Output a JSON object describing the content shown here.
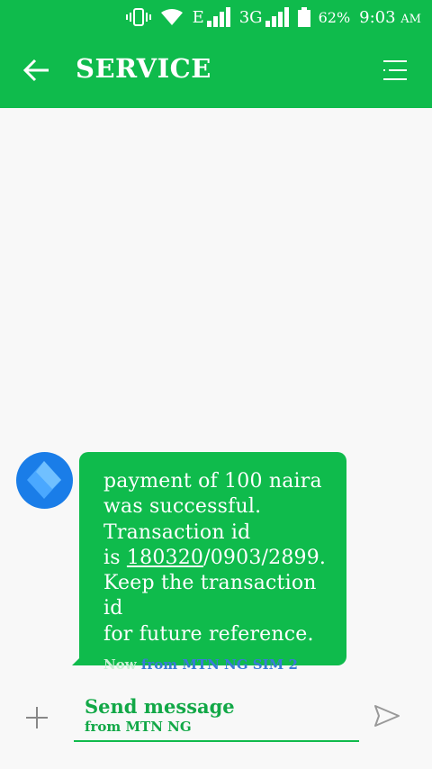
{
  "status_bar": {
    "network_type_1": "E",
    "network_type_2": "3G",
    "battery": "62%",
    "time": "9:03",
    "ampm": "AM"
  },
  "header": {
    "title": "SERVICE"
  },
  "message": {
    "line1": "payment of 100 naira",
    "line2": "was successful.",
    "line3": "Transaction id",
    "line4_prefix": "is ",
    "line4_underlined": "180320",
    "line4_suffix": "/0903/2899.",
    "line5": "Keep the transaction id",
    "line6": "for future reference.",
    "time": "Now",
    "sim": "from MTN NG SIM 2"
  },
  "compose": {
    "placeholder": "Send message",
    "sub": "from MTN NG"
  },
  "colors": {
    "accent": "#0fbb4c",
    "avatar": "#1a7de8",
    "sim_label": "#3a7ad8"
  }
}
